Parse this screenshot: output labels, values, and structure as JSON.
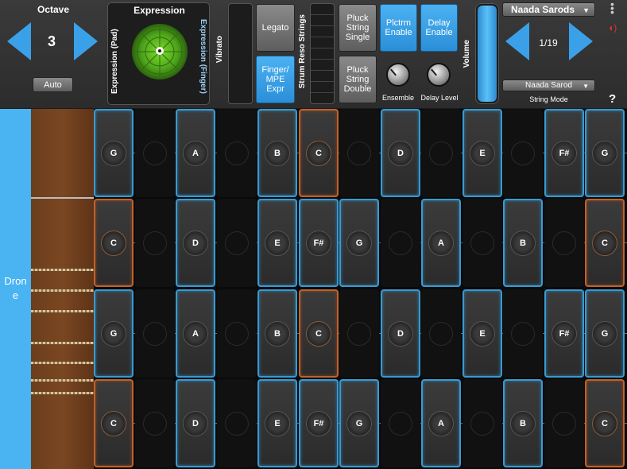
{
  "octave": {
    "label": "Octave",
    "value": "3",
    "auto_label": "Auto"
  },
  "expression": {
    "title": "Expression",
    "pad_label": "Expression (Pad)",
    "finger_label": "Expression (Finger)"
  },
  "vibrato_label": "Vibrato",
  "legato_label": "Legato",
  "finger_mpe_label": "Finger/ MPE Expr",
  "strum_label": "Strum Reso Strings",
  "pluck_single_label": "Pluck String Single",
  "pluck_double_label": "Pluck String Double",
  "plectrum_label": "Plctrm Enable",
  "delay_enable_label": "Delay Enable",
  "ensemble_label": "Ensemble",
  "delay_level_label": "Delay Level",
  "volume_label": "Volume",
  "preset": {
    "name": "Naada Sarods",
    "counter": "1/19",
    "string_mode_value": "Naada Sarod",
    "string_mode_label": "String Mode"
  },
  "help_label": "?",
  "drone_label": "Drone",
  "grid": {
    "rows": [
      [
        "G",
        "",
        "A",
        "",
        "B",
        "C",
        "",
        "D",
        "",
        "E",
        "",
        "F#",
        "G"
      ],
      [
        "C",
        "",
        "D",
        "",
        "E",
        "F#",
        "G",
        "",
        "A",
        "",
        "B",
        "C"
      ],
      [
        "G",
        "",
        "A",
        "",
        "B",
        "C",
        "",
        "D",
        "",
        "E",
        "",
        "F#",
        "G"
      ],
      [
        "C",
        "",
        "D",
        "",
        "E",
        "F#",
        "G",
        "",
        "A",
        "",
        "B",
        "C"
      ]
    ]
  },
  "colors": {
    "accent": "#3aa0e8",
    "orange": "#c0622d",
    "wood": "#6b3e1c"
  }
}
